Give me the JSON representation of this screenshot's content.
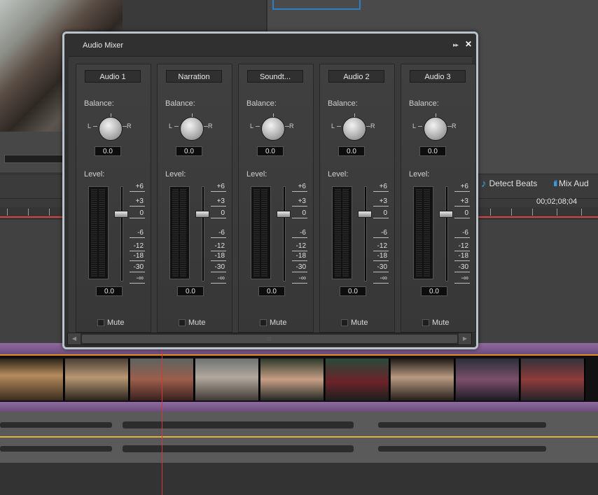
{
  "timeline": {
    "detect_beats_label": "Detect Beats",
    "mix_audio_label": "Mix Aud",
    "timecode": "00;02;08;04"
  },
  "mixer": {
    "title": "Audio Mixer",
    "menu_glyph": "▸▸",
    "close_glyph": "✕",
    "balance_label": "Balance:",
    "level_label": "Level:",
    "left_label": "L",
    "right_label": "R",
    "mute_label": "Mute",
    "scale": [
      "+6",
      "+3",
      "0",
      "-6",
      "-12",
      "-18",
      "-30",
      "-∞"
    ],
    "strips": [
      {
        "name": "Audio 1",
        "balance": "0.0",
        "level": "0.0"
      },
      {
        "name": "Narration",
        "balance": "0.0",
        "level": "0.0"
      },
      {
        "name": "Soundt...",
        "balance": "0.0",
        "level": "0.0"
      },
      {
        "name": "Audio 2",
        "balance": "0.0",
        "level": "0.0"
      },
      {
        "name": "Audio 3",
        "balance": "0.0",
        "level": "0.0"
      }
    ]
  }
}
